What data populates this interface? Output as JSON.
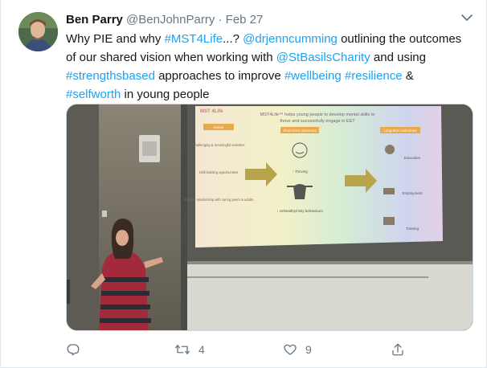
{
  "tweet": {
    "author_name": "Ben Parry",
    "handle": "@BenJohnParry",
    "separator": " · ",
    "date": "Feb 27",
    "text_parts": [
      {
        "t": "Why PIE and why "
      },
      {
        "t": "#MST4Life",
        "link": true
      },
      {
        "t": "...? "
      },
      {
        "t": "@drjenncumming",
        "link": true
      },
      {
        "t": " outlining the outcomes of our shared vision when working with "
      },
      {
        "t": "@StBasilsCharity",
        "link": true
      },
      {
        "t": " and using "
      },
      {
        "t": "#strengthsbased",
        "link": true
      },
      {
        "t": " approaches to improve "
      },
      {
        "t": "#wellbeing",
        "link": true
      },
      {
        "t": " "
      },
      {
        "t": "#resilience",
        "link": true
      },
      {
        "t": " & "
      },
      {
        "t": "#selfworth",
        "link": true
      },
      {
        "t": " in young people"
      }
    ]
  },
  "slide": {
    "title_line1": "MST4Life™ helps young people to develop mental skills to",
    "title_line2": "thrive and successfully engage in EET",
    "logo": "MST 4Life",
    "inputs_header": "Inputs",
    "inputs": [
      "Challenging & meaningful activities",
      "Skill building opportunities",
      "Positive relationship with caring peers & adults"
    ],
    "short_header": "Short term outcomes",
    "short_up": "↑ Thriving",
    "short_down": "↓ Unhealthy/risky behaviours",
    "long_header": "Long term outcomes",
    "long": [
      "Education",
      "Employment",
      "Training"
    ]
  },
  "actions": {
    "reply_count": "",
    "retweet_count": "4",
    "like_count": "9"
  },
  "colors": {
    "link": "#1da1f2",
    "muted": "#657786"
  }
}
